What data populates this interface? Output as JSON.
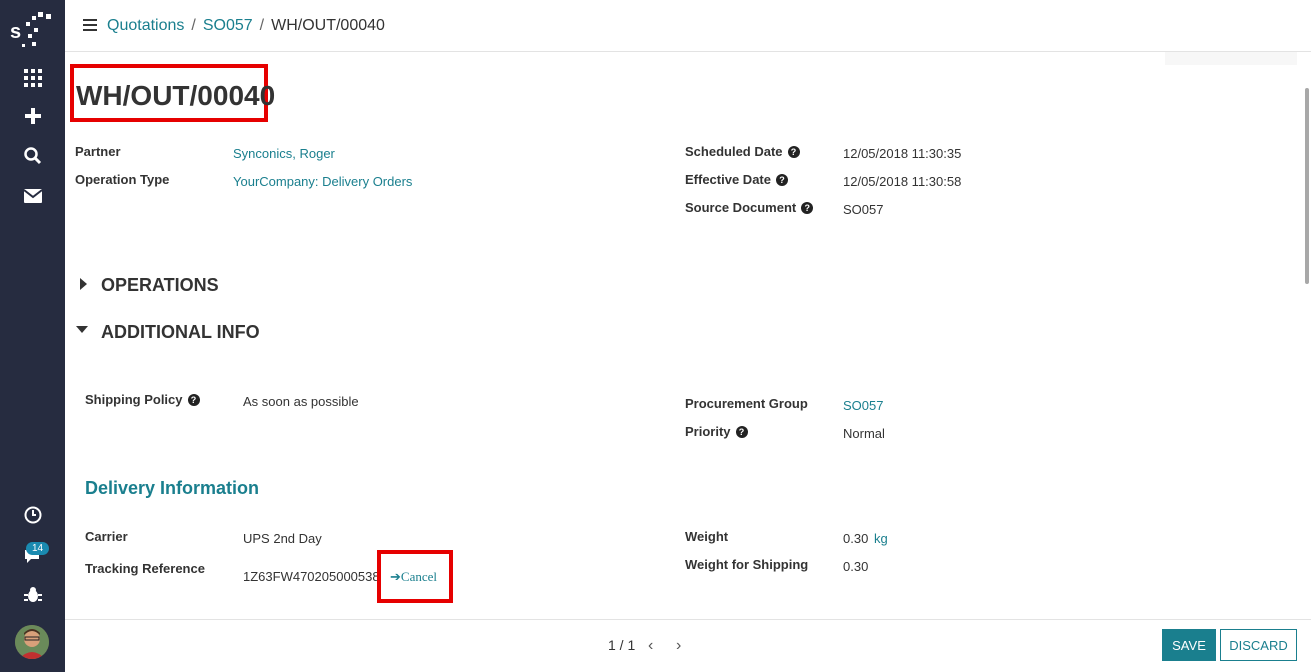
{
  "sidebar": {
    "icons": [
      "apps-icon",
      "plus-icon",
      "search-icon",
      "mail-icon",
      "clock-icon",
      "chat-icon",
      "bug-icon"
    ],
    "chat_badge": "14"
  },
  "breadcrumb": {
    "items": [
      "Quotations",
      "SO057"
    ],
    "current": "WH/OUT/00040"
  },
  "record": {
    "title": "WH/OUT/00040",
    "partner_label": "Partner",
    "partner_value": "Synconics, Roger",
    "operation_type_label": "Operation Type",
    "operation_type_value": "YourCompany: Delivery Orders",
    "scheduled_date_label": "Scheduled Date",
    "scheduled_date_value": "12/05/2018 11:30:35",
    "effective_date_label": "Effective Date",
    "effective_date_value": "12/05/2018 11:30:58",
    "source_document_label": "Source Document",
    "source_document_value": "SO057"
  },
  "sections": {
    "operations": "OPERATIONS",
    "additional_info": "ADDITIONAL INFO"
  },
  "additional": {
    "shipping_policy_label": "Shipping Policy",
    "shipping_policy_value": "As soon as possible",
    "procurement_group_label": "Procurement Group",
    "procurement_group_value": "SO057",
    "priority_label": "Priority",
    "priority_value": "Normal"
  },
  "delivery": {
    "heading": "Delivery Information",
    "carrier_label": "Carrier",
    "carrier_value": "UPS 2nd Day",
    "tracking_label": "Tracking Reference",
    "tracking_value": "1Z63FW470205000538",
    "cancel_label": "Cancel",
    "weight_label": "Weight",
    "weight_value": "0.30",
    "weight_unit": "kg",
    "weight_shipping_label": "Weight for Shipping",
    "weight_shipping_value": "0.30"
  },
  "pager": {
    "text": "1 / 1"
  },
  "buttons": {
    "save": "SAVE",
    "discard": "DISCARD"
  },
  "colors": {
    "accent": "#1a7f8e",
    "sidebar": "#262c40",
    "highlight": "#e60000"
  }
}
